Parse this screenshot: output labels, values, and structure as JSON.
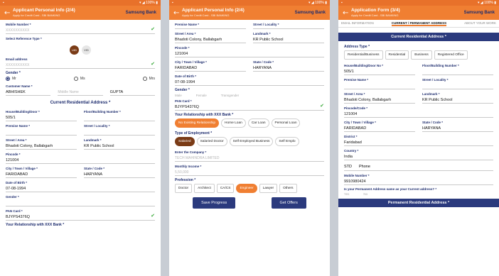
{
  "status": {
    "time": "11:44",
    "signal": "▾ ◢ 100% ▮"
  },
  "screen1": {
    "title": "Applicant Personal Info (2/4)",
    "subtitle": "Apply for Credit Card - SBI BANKING",
    "bank": "Samsung Bank",
    "mobile_label": "Mobile Number *",
    "mobile_value": "XXXXXXXXXX",
    "id_type_label": "Select Reference Type *",
    "id_types": [
      "UID",
      "VID"
    ],
    "email_label": "Email address",
    "email_value": "XXXXXXXXXX",
    "gender_label": "Gender *",
    "genders": [
      "Mr",
      "Ms",
      "Mrs"
    ],
    "name_label": "Customer Name *",
    "name_first": "ABHISHEK",
    "name_middle": "Middle Name",
    "name_last": "GUPTA",
    "section_title": "Current Residential Address *",
    "house_label": "House/Building/Door *",
    "house_value": "505/1",
    "house2_label": "Floor/Building Number *",
    "premise_label": "Premise Name *",
    "society_label": "Street / Locality *",
    "street_label": "Street / Area *",
    "street_value": "Bhadoti Colony, Ballabgarh",
    "landmark_label": "Landmark *",
    "landmark_value": "KR Public School",
    "pincode_label": "Pincode *",
    "pincode_value": "121004",
    "city_label": "City / Town / Village *",
    "city_value": "FARIDABAD",
    "state_label": "State / Code *",
    "state_value": "HARYANA",
    "dob_label": "Date of Birth *",
    "dob_value": "07-08-1994",
    "gender2_label": "Gender *",
    "pan_label": "PAN Card *",
    "pan_value": "BJYPS4376Q",
    "relation_label": "Your Relationship with XXX Bank *"
  },
  "screen2": {
    "title": "Applicant Personal Info (2/4)",
    "subtitle": "Apply for Credit Card - SBI BANKING",
    "bank": "Samsung Bank",
    "top_left_label": "Premise Name *",
    "top_right_label": "Street / Locality *",
    "street_label": "Street / Area *",
    "street_value": "Bhadoti Colony, Ballabgarh",
    "landmark_label": "Landmark *",
    "landmark_value": "KR Public School",
    "pincode_label": "Pincode *",
    "pincode_value": "121004",
    "city_label": "City / Town / Village *",
    "city_value": "FARIDABAD",
    "state_label": "State / Code *",
    "state_value": "HARYANA",
    "dob_label": "Date of Birth *",
    "dob_value": "07-08-1994",
    "gender_label": "Gender *",
    "gender_opts": [
      "Male",
      "Female",
      "Transgender"
    ],
    "pan_label": "PAN Card *",
    "pan_value": "BJYPS4376Q",
    "relation_label": "Your Relationship with XXX Bank *",
    "relations": [
      "No Existing Relationship",
      "Home Loan",
      "Car Loan",
      "Personal Loan"
    ],
    "employment_label": "Type of Employment *",
    "employments": [
      "Salaried",
      "Salaried Doctor",
      "Self Employed Business",
      "Self Emplo"
    ],
    "employer_label": "Enter the Company *",
    "employer_value": "TECH MAHINDRA LIMITED",
    "income_label": "Monthly Income *",
    "income_value": "5,50,000",
    "profession_label": "Profession *",
    "professions": [
      "Doctor",
      "Architect",
      "CA/CS",
      "Engineer",
      "Lawyer",
      "Others"
    ],
    "save_label": "Save Progress",
    "offers_label": "Get Offers"
  },
  "screen3": {
    "title": "Application Form (3/4)",
    "subtitle": "Apply for Credit Card - SBI BANKING",
    "bank": "Samsung Bank",
    "tabs": [
      "EMAIL INFORMATION",
      "CURRENT / PERMANENT ADDRESS",
      "ABOUT YOUR WORK"
    ],
    "section_title": "Current Residential Address *",
    "addr_type_label": "Address Type *",
    "addr_types": [
      "Residential/Business",
      "Residential",
      "Business",
      "Registered Office"
    ],
    "house_label": "House/Building/Door No *",
    "house_value": "505/1",
    "floor_label": "Floor/Building Number *",
    "premise_label": "Premise Name *",
    "locality_label": "Street / Locality *",
    "street_label": "Street / Area *",
    "street_value": "Bhadoti Colony, Ballabgarh",
    "landmark_label": "Landmark *",
    "landmark_value": "KR Public School",
    "pincode_label": "Pincode/Code *",
    "pincode_value": "121004",
    "city_label": "City / Town / Village *",
    "city_value": "FARIDABAD",
    "state_label": "State / Code *",
    "state_value": "HARYANA",
    "district_label": "District *",
    "district_value": "Faridabad",
    "country_label": "Country *",
    "country_value": "India",
    "std_value": "STD",
    "phone_label": "Phone",
    "mobile_label": "Mobile Number *",
    "mobile_value": "9910980424",
    "permanent_q": "Is your Permanent Address same as your Current address? *",
    "yes_no": [
      "Yes",
      "No"
    ],
    "permanent_section": "Permanent Residential Address *"
  }
}
